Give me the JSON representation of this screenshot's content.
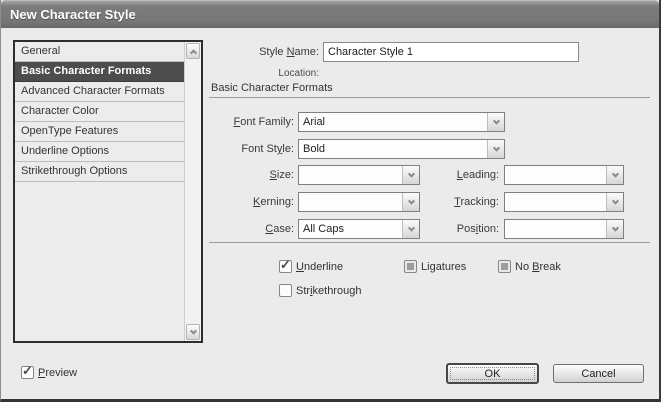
{
  "dialog": {
    "title": "New Character Style",
    "location_label": "Location:",
    "section_heading": "Basic Character Formats"
  },
  "style_list": {
    "items": [
      {
        "label": "General",
        "selected": false
      },
      {
        "label": "Basic Character Formats",
        "selected": true
      },
      {
        "label": "Advanced Character Formats",
        "selected": false
      },
      {
        "label": "Character Color",
        "selected": false
      },
      {
        "label": "OpenType Features",
        "selected": false
      },
      {
        "label": "Underline Options",
        "selected": false
      },
      {
        "label": "Strikethrough Options",
        "selected": false
      }
    ]
  },
  "fields": {
    "style_name": {
      "label": "Style &Name:",
      "value": "Character Style 1"
    },
    "font_family": {
      "label": "&Font Family:",
      "value": "Arial"
    },
    "font_style": {
      "label": "Font St&yle:",
      "value": "Bold"
    },
    "size": {
      "label": "&Size:",
      "value": ""
    },
    "leading": {
      "label": "&Leading:",
      "value": ""
    },
    "kerning": {
      "label": "&Kerning:",
      "value": ""
    },
    "tracking": {
      "label": "&Tracking:",
      "value": ""
    },
    "case": {
      "label": "&Case:",
      "value": "All Caps"
    },
    "position": {
      "label": "Pos&ition:",
      "value": ""
    }
  },
  "checkboxes": {
    "underline": {
      "label": "&Underline",
      "state": "checked"
    },
    "ligatures": {
      "label": "Li&gatures",
      "state": "mixed"
    },
    "no_break": {
      "label": "No &Break",
      "state": "mixed"
    },
    "strikethrough": {
      "label": "Str&ikethrough",
      "state": "unchecked"
    },
    "preview": {
      "label": "&Preview",
      "state": "checked"
    }
  },
  "buttons": {
    "ok": "OK",
    "cancel": "Cancel"
  },
  "icons": {
    "check": "✓"
  },
  "colors": {
    "titlebar": "#7c7c7c",
    "dialog_bg": "#ebebeb",
    "selected_item_bg": "#4d4d4d",
    "selected_item_text": "#ffffff",
    "field_border": "#8a8a8a"
  }
}
